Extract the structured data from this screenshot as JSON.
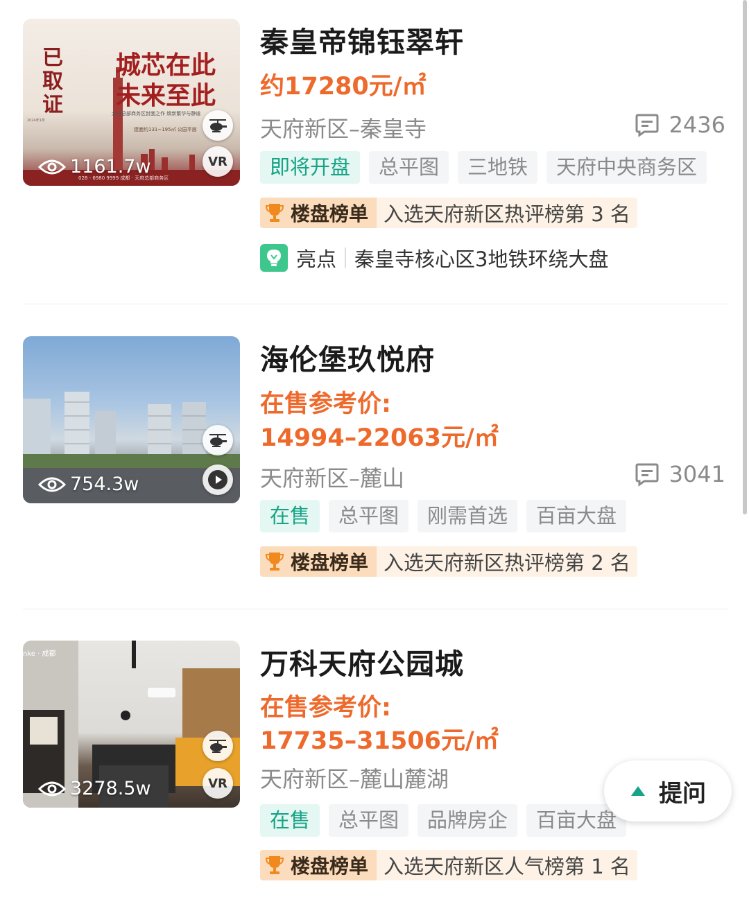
{
  "listings": [
    {
      "title": "秦皇帝锦钰翠轩",
      "price_line1": "约17280元/㎡",
      "price_line2": "",
      "district": "天府新区–秦皇寺",
      "comments": "2436",
      "views": "1161.7w",
      "media_badge": "VR",
      "thumb_text": {
        "badge": "已取证",
        "headline1": "城芯在此",
        "headline2": "未来至此",
        "sub": "大府总部商务区封面之作 焕新繁华与静谧",
        "area": "建面约131~195㎡ 公园平层",
        "phone": "028 - 6980 9999  成都 · 天府总部商务区"
      },
      "tags": [
        {
          "label": "即将开盘",
          "status": true
        },
        {
          "label": "总平图",
          "status": false
        },
        {
          "label": "三地铁",
          "status": false
        },
        {
          "label": "天府中央商务区",
          "status": false
        }
      ],
      "rank": {
        "head": "楼盘榜单",
        "text": "入选天府新区热评榜第 3 名"
      },
      "highlight": {
        "label": "亮点",
        "text": "秦皇寺核心区3地铁环绕大盘"
      }
    },
    {
      "title": "海伦堡玖悦府",
      "price_line1": "在售参考价:",
      "price_line2": "14994–22063元/㎡",
      "district": "天府新区–麓山",
      "comments": "3041",
      "views": "754.3w",
      "media_badge": "play",
      "tags": [
        {
          "label": "在售",
          "status": true
        },
        {
          "label": "总平图",
          "status": false
        },
        {
          "label": "刚需首选",
          "status": false
        },
        {
          "label": "百亩大盘",
          "status": false
        }
      ],
      "rank": {
        "head": "楼盘榜单",
        "text": "入选天府新区热评榜第 2 名"
      }
    },
    {
      "title": "万科天府公园城",
      "price_line1": "在售参考价:",
      "price_line2": "17735–31506元/㎡",
      "district": "天府新区–麓山麓湖",
      "comments": "",
      "views": "3278.5w",
      "media_badge": "VR",
      "thumb_text": {
        "brand": "nke · 成都"
      },
      "tags": [
        {
          "label": "在售",
          "status": true
        },
        {
          "label": "总平图",
          "status": false
        },
        {
          "label": "品牌房企",
          "status": false
        },
        {
          "label": "百亩大盘",
          "status": false
        }
      ],
      "rank": {
        "head": "楼盘榜单",
        "text": "入选天府新区人气榜第 1 名"
      }
    }
  ],
  "ask_button": {
    "label": "提问",
    "icon": "triangle-up-icon"
  },
  "icons": {
    "views": "eye-icon",
    "comments": "comment-icon",
    "rank": "trophy-icon",
    "highlight": "lightbulb-icon",
    "vr": "vr-icon",
    "play": "play-icon",
    "panorama": "helicopter-icon"
  },
  "colors": {
    "price": "#ee6a2c",
    "status_tag_text": "#16a387",
    "status_tag_bg": "#e5f7f2",
    "rank_head_bg": "#fbdcbd",
    "rank_bg": "#fdf2e5",
    "highlight_icon": "#3ec78c"
  }
}
